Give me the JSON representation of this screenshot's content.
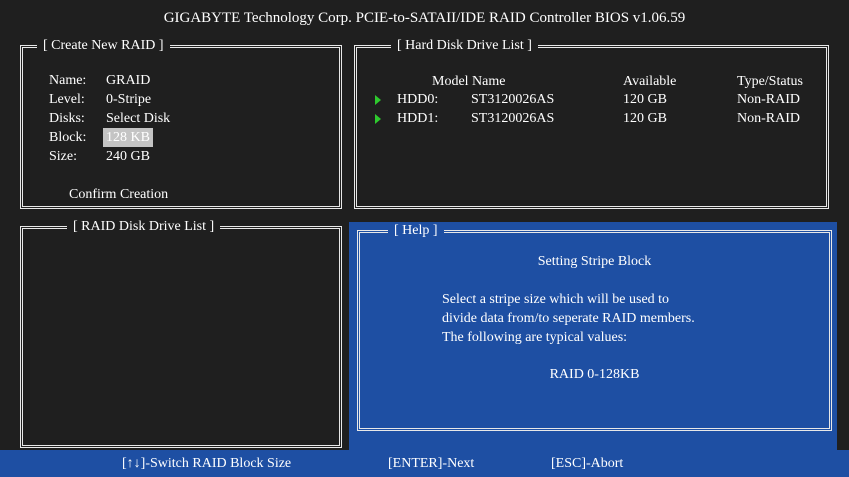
{
  "window": {
    "title": "GIGABYTE Technology Corp. PCIE-to-SATAII/IDE RAID Controller BIOS v1.06.59"
  },
  "create_raid": {
    "title": "[ Create New RAID ]",
    "fields": [
      {
        "label": "Name:",
        "value": "GRAID"
      },
      {
        "label": "Level:",
        "value": "0-Stripe"
      },
      {
        "label": "Disks:",
        "value": "Select Disk"
      },
      {
        "label": "Block:",
        "value": "128 KB",
        "selected": true
      },
      {
        "label": "Size:",
        "value": "240 GB"
      }
    ],
    "confirm_label": "Confirm Creation"
  },
  "hdd_list": {
    "title": "[ Hard Disk Drive List ]",
    "columns": [
      "Model Name",
      "Available",
      "Type/Status"
    ],
    "rows": [
      {
        "id": "HDD0:",
        "model": "ST3120026AS",
        "available": "120 GB",
        "status": "Non-RAID"
      },
      {
        "id": "HDD1:",
        "model": "ST3120026AS",
        "available": "120 GB",
        "status": "Non-RAID"
      }
    ]
  },
  "raid_list": {
    "title": "[ RAID Disk Drive List ]"
  },
  "help": {
    "title": "[ Help ]",
    "heading": "Setting Stripe Block",
    "lines": [
      "Select a stripe size which will be used to",
      "divide data from/to seperate RAID members.",
      "The following are typical values:"
    ],
    "example": "RAID 0-128KB"
  },
  "footer": {
    "switch": "[↑↓]-Switch RAID Block Size",
    "next": "[ENTER]-Next",
    "abort": "[ESC]-Abort"
  },
  "colors": {
    "background": "#1f1f1f",
    "help_blue": "#1e4fa3",
    "selection": "#c4c4c4",
    "arrow_green": "#2ec92e"
  }
}
